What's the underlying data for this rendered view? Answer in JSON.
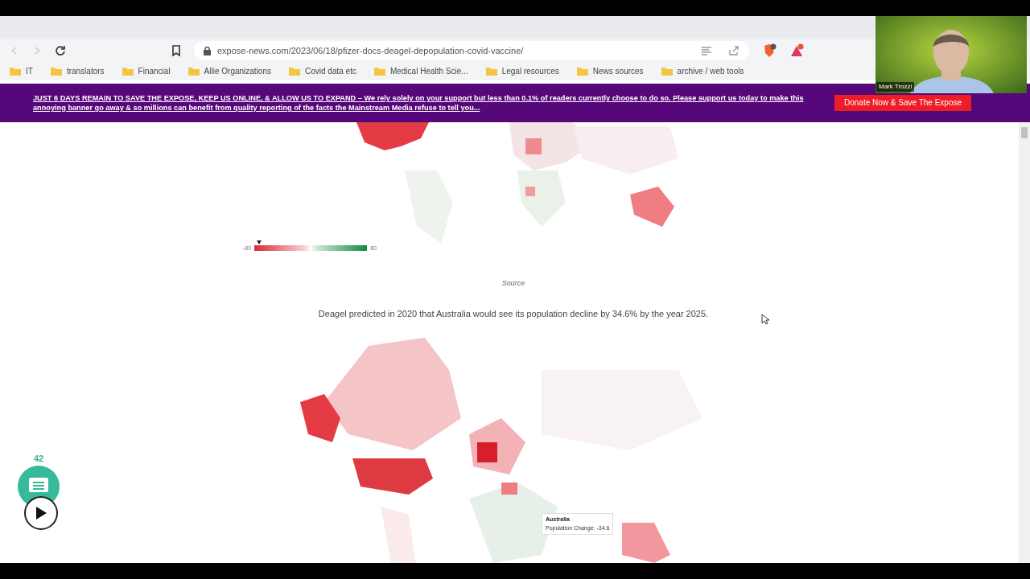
{
  "browser": {
    "url": "expose-news.com/2023/06/18/pfizer-docs-deagel-depopulation-covid-vaccine/",
    "bookmarks": [
      "IT",
      "translators",
      "Financial",
      "Allie Organizations",
      "Covid data etc",
      "Medical Health Scie...",
      "Legal resources",
      "News sources",
      "archive / web tools"
    ]
  },
  "banner": {
    "text": "JUST 6 DAYS REMAIN TO SAVE THE EXPOSE, KEEP US ONLINE, & ALLOW US TO EXPAND – We rely solely on your support but less than 0.1% of readers currently choose to do so. Please support us today to make this annoying banner go away & so millions can benefit from quality reporting of the facts the Mainstream Media refuse to tell you...",
    "button": "Donate Now & Save The Expose"
  },
  "legend": {
    "min": "-80",
    "max": "80",
    "level": 0.04
  },
  "source": "Source",
  "paragraph": "Deagel predicted in 2020 that Australia would see its population decline by 34.6% by the year 2025.",
  "tooltip": {
    "title": "Australia",
    "text": "Population Change: -34.6"
  },
  "comments": {
    "count": "42"
  },
  "webcam": {
    "name": "Mark Trozzi"
  }
}
